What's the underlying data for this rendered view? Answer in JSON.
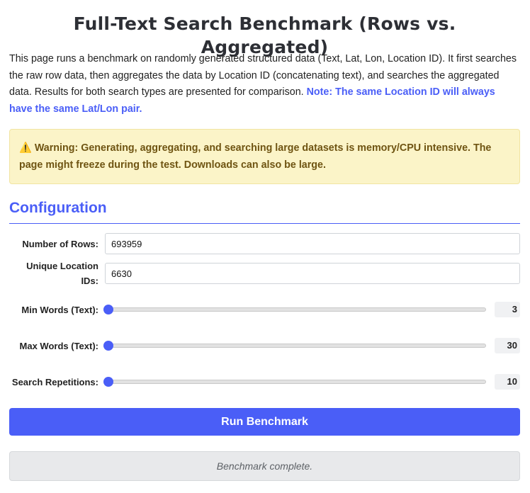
{
  "header": {
    "title": "Full-Text Search Benchmark (Rows vs. Aggregated)"
  },
  "intro": {
    "text": "This page runs a benchmark on randomly generated structured data (Text, Lat, Lon, Location ID). It first searches the raw row data, then aggregates the data by Location ID (concatenating text), and searches the aggregated data. Results for both search types are presented for comparison.",
    "note": "Note: The same Location ID will always have the same Lat/Lon pair."
  },
  "warning": {
    "icon": "warning-icon",
    "icon_glyph": "⚠️",
    "text": "Warning: Generating, aggregating, and searching large datasets is memory/CPU intensive. The page might freeze during the test. Downloads can also be large."
  },
  "config": {
    "heading": "Configuration",
    "num_rows": {
      "label": "Number of Rows:",
      "value": "693959"
    },
    "unique_ids": {
      "label": "Unique Location IDs:",
      "value": "6630"
    },
    "min_words": {
      "label": "Min Words (Text):",
      "value": "3",
      "fraction": 0.0
    },
    "max_words": {
      "label": "Max Words (Text):",
      "value": "30",
      "fraction": 0.0
    },
    "search_reps": {
      "label": "Search Repetitions:",
      "value": "10",
      "fraction": 0.0
    }
  },
  "actions": {
    "run_label": "Run Benchmark"
  },
  "status": {
    "text": "Benchmark complete."
  },
  "colors": {
    "accent": "#4a5ef7",
    "warning_bg": "#fbf4c8",
    "warning_text": "#6f5412"
  }
}
